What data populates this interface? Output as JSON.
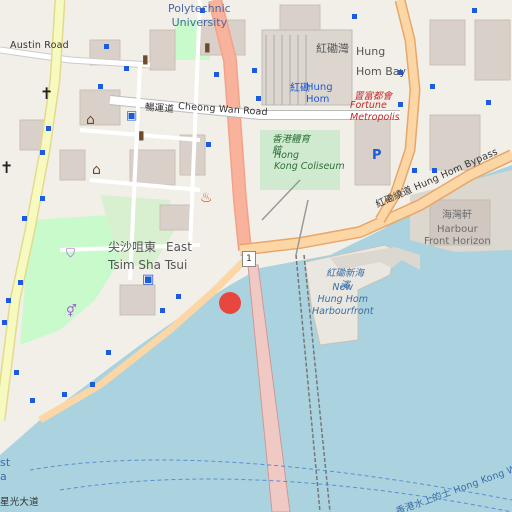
{
  "map": {
    "labels": {
      "polytechnic": "Polytechnic\nUniversity",
      "austin_road": "Austin Road",
      "cheong_wan": "Cheong Wan Road",
      "cheong_wan_zh": "暢運道",
      "hung_hom_bay_zh": "紅磡灣",
      "hung_hom_bay": "Hung\nHom Bay",
      "hung_hom_zh": "紅磡",
      "hung_hom": "Hung\nHom",
      "fortune_zh": "置富都會",
      "fortune": "Fortune\nMetropolis",
      "coliseum_zh": "香港體育\n館",
      "coliseum": "Hong\nKong Coliseum",
      "tst_zh": "尖沙咀東",
      "tst_en1": "East",
      "tst_en2": "Tsim Sha Tsui",
      "bypass": "紅磡繞道 Hung Hom Bypass",
      "harbour_zh": "海灣軒",
      "harbour": "Harbour\nFront Horizon",
      "new_hh_zh": "紅磡新海\n濱",
      "new_hh": "New\nHung Hom\nHarbourfront",
      "route_shield": "1",
      "star_ferry": "香港水上的士 Hong Kong W",
      "bottom_left_zh": "星光大道",
      "left_frag": "st",
      "left_frag2": "a"
    },
    "colors": {
      "water": "#aad3df",
      "land": "#f2efe9",
      "park": "#c8facc",
      "building": "#d9d0c9",
      "major_road": "#fcd6a4",
      "trunk_road": "#f9b29c",
      "secondary": "#f7fabf",
      "railway": "#999999",
      "marker": "#e8473e",
      "transit_stop": "#1b5bdc"
    },
    "icons": [
      "marker-icon",
      "bus-stop-icon",
      "cross-icon",
      "museum-icon",
      "library-icon",
      "bus-station-icon",
      "fire-station-icon",
      "parking-icon",
      "shopping-icon",
      "toilet-icon"
    ]
  }
}
